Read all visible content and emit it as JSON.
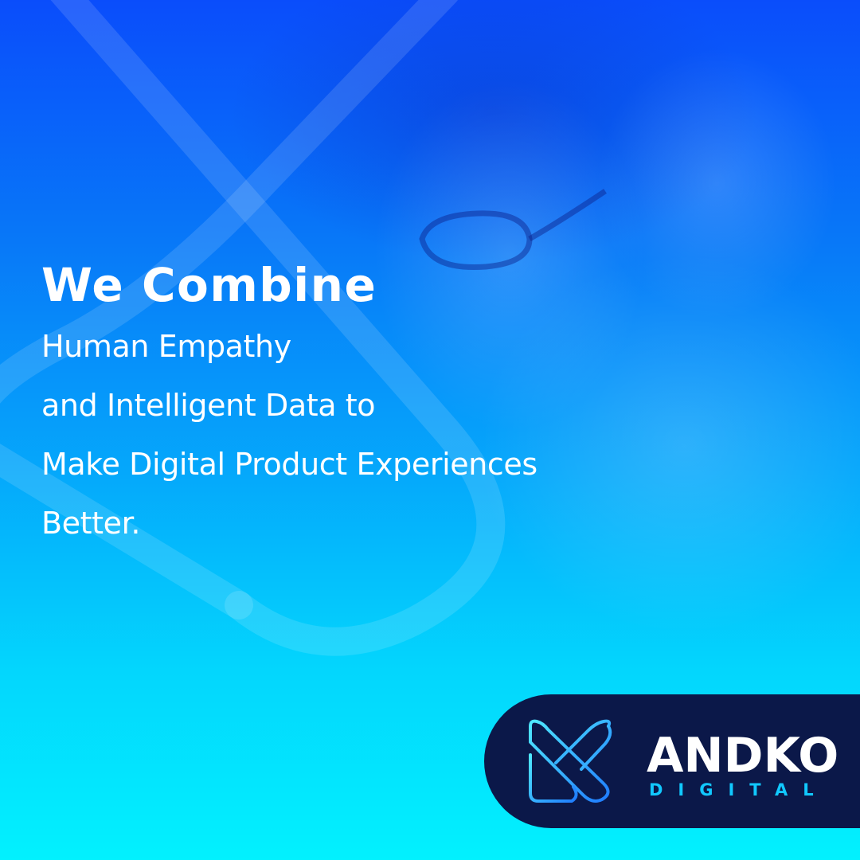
{
  "headline": "We Combine",
  "body_lines": [
    "Human Empathy",
    "and Intelligent Data to",
    "Make Digital Product Experiences",
    "Better."
  ],
  "brand": {
    "name": "ANDKO",
    "subtitle": "DIGITAL",
    "pill_color": "#0b1849",
    "accent_color": "#11c8ff"
  },
  "colors": {
    "gradient_top": "#0a4dfb",
    "gradient_bottom": "#02f1fe",
    "text": "#ffffff"
  }
}
